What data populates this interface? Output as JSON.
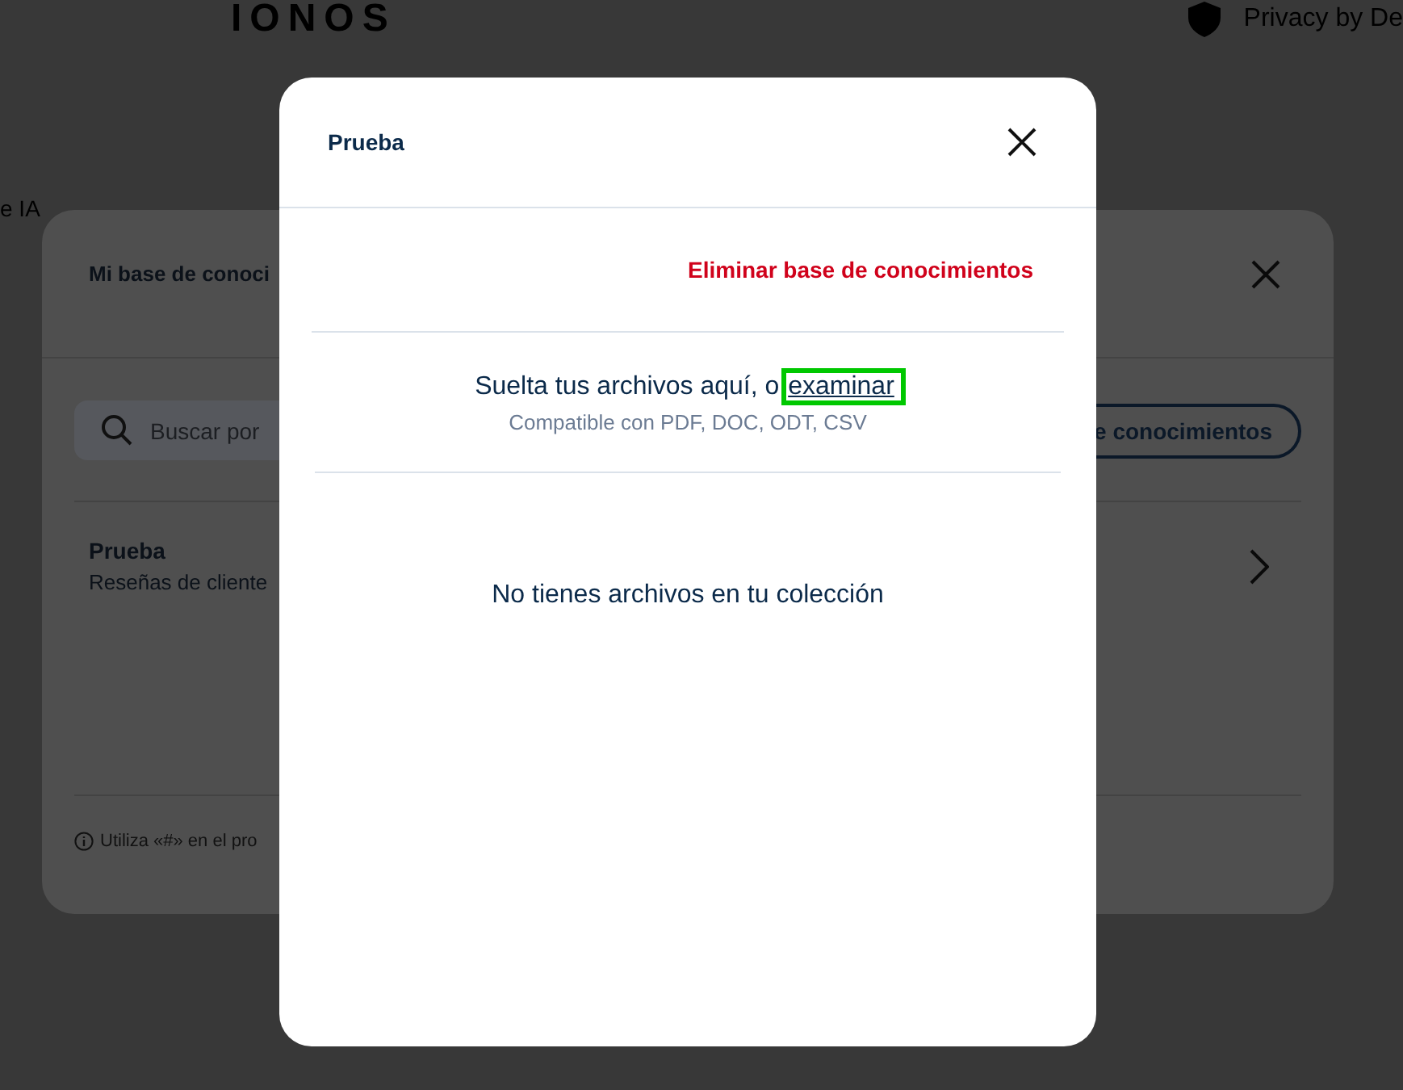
{
  "page": {
    "logo": "IONOS",
    "privacy_link": "Privacy by De",
    "side_text": "e IA"
  },
  "background_dialog": {
    "title": "Mi base de conoci",
    "search": {
      "placeholder": "Buscar por"
    },
    "create_button": "e conocimientos",
    "items": [
      {
        "name": "Prueba",
        "description": "Reseñas de cliente"
      }
    ],
    "hint": "Utiliza «#» en el pro"
  },
  "dialog": {
    "title": "Prueba",
    "delete_link": "Eliminar base de conocimientos",
    "dropzone": {
      "text": "Suelta tus archivos aquí, o",
      "browse_link": {
        "label": "examinar",
        "focused": true
      },
      "formats": "Compatible con PDF, DOC, ODT, CSV"
    },
    "empty_message": "No tienes archivos en tu colección"
  }
}
